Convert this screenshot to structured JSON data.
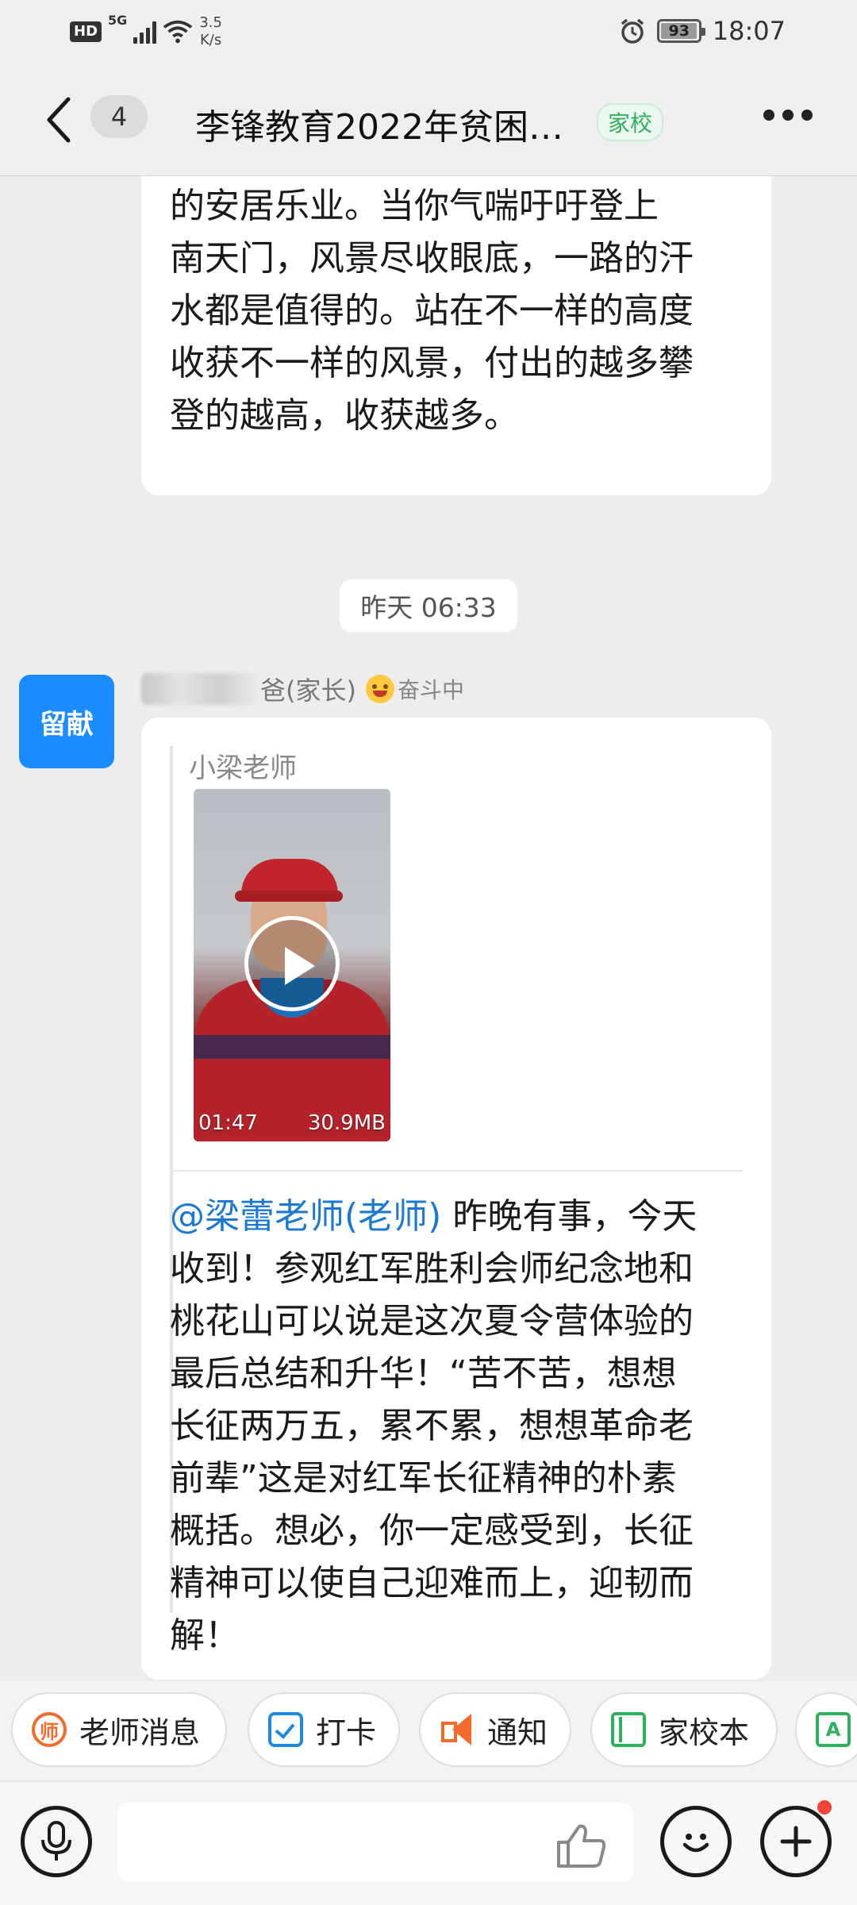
{
  "status_bar": {
    "hd": "HD",
    "network": "5G",
    "speed_value": "3.5",
    "speed_unit": "K/s",
    "battery": "93",
    "time": "18:07"
  },
  "header": {
    "unread_count": "4",
    "title": "李锋教育2022年贫困…",
    "tag": "家校"
  },
  "messages": {
    "top_bubble_text": "劳，抛头颅撒热血，才有后人今天\n的安居乐业。当你气喘吁吁登上\n南天门，风景尽收眼底，一路的汗\n水都是值得的。站在不一样的高度\n收获不一样的风景，付出的越多攀\n登的越高，收获越多。",
    "timestamp": "昨天 06:33",
    "sender": {
      "avatar_text": "留献",
      "name_suffix": "爸(家长)",
      "status": "奋斗中"
    },
    "quote": {
      "author": "小梁老师",
      "video_duration": "01:47",
      "video_size": "30.9MB"
    },
    "mention": "@梁蕾老师(老师)",
    "body_text": " 昨晚有事，今天\n收到！参观红军胜利会师纪念地和\n桃花山可以说是这次夏令营体验的\n最后总结和升华！“苦不苦，想想\n长征两万五，累不累，想想革命老\n前辈”这是对红军长征精神的朴素\n概括。想必，你一定感受到，长征\n精神可以使自己迎难而上，迎韧而\n解！"
  },
  "quick_actions": [
    {
      "label": "老师消息",
      "icon": "teacher-icon",
      "color": "#f26b2a"
    },
    {
      "label": "打卡",
      "icon": "checkin-icon",
      "color": "#1e88e5"
    },
    {
      "label": "通知",
      "icon": "megaphone-icon",
      "color": "#f26b2a"
    },
    {
      "label": "家校本",
      "icon": "notebook-icon",
      "color": "#2fb05a"
    },
    {
      "label": "",
      "icon": "ai-text-icon",
      "color": "#2fb05a"
    }
  ],
  "input_bar": {
    "placeholder": ""
  },
  "colors": {
    "accent_blue": "#1a8cff",
    "mention_blue": "#1a78d6",
    "school_tag_green": "#2fb05a",
    "notification_red": "#f0443a"
  }
}
